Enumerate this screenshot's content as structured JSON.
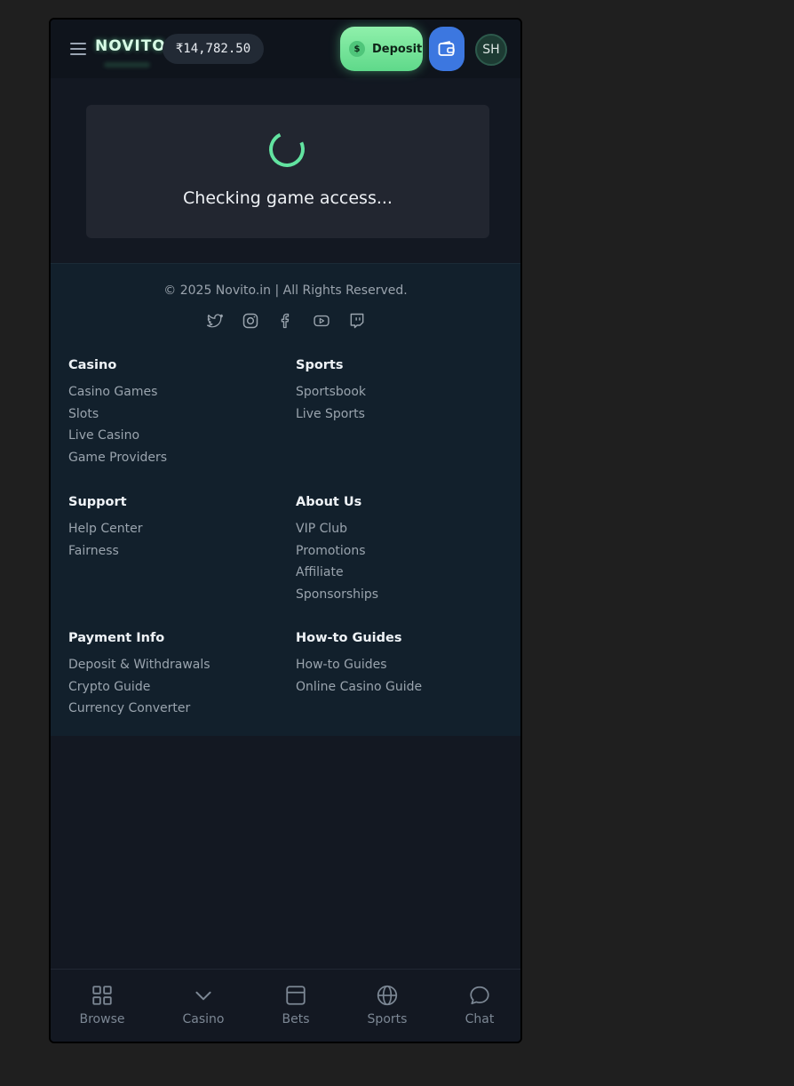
{
  "header": {
    "logo": "NOVITO",
    "balance": "₹14,782.50",
    "deposit_label": "Deposit",
    "deposit_coin": "$",
    "avatar_initials": "SH"
  },
  "loading": {
    "message": "Checking game access..."
  },
  "footer": {
    "copyright": "© 2025 Novito.in | All Rights Reserved.",
    "socials": [
      "twitter-icon",
      "instagram-icon",
      "facebook-icon",
      "youtube-icon",
      "twitch-icon"
    ],
    "columns": [
      {
        "title": "Casino",
        "links": [
          "Casino Games",
          "Slots",
          "Live Casino",
          "Game Providers"
        ]
      },
      {
        "title": "Sports",
        "links": [
          "Sportsbook",
          "Live Sports"
        ]
      },
      {
        "title": "Support",
        "links": [
          "Help Center",
          "Fairness"
        ]
      },
      {
        "title": "About Us",
        "links": [
          "VIP Club",
          "Promotions",
          "Affiliate",
          "Sponsorships"
        ]
      },
      {
        "title": "Payment Info",
        "links": [
          "Deposit & Withdrawals",
          "Crypto Guide",
          "Currency Converter"
        ]
      },
      {
        "title": "How-to Guides",
        "links": [
          "How-to Guides",
          "Online Casino Guide"
        ]
      }
    ]
  },
  "bottom_nav": {
    "items": [
      {
        "label": "Browse",
        "icon": "grid-icon"
      },
      {
        "label": "Casino",
        "icon": "chevron-down-icon"
      },
      {
        "label": "Bets",
        "icon": "betslip-icon"
      },
      {
        "label": "Sports",
        "icon": "globe-icon"
      },
      {
        "label": "Chat",
        "icon": "chat-icon"
      }
    ]
  },
  "colors": {
    "accent_green": "#62e3a0",
    "wallet_blue": "#3c77e0",
    "background": "#131822",
    "footer_bg": "#12202c"
  }
}
